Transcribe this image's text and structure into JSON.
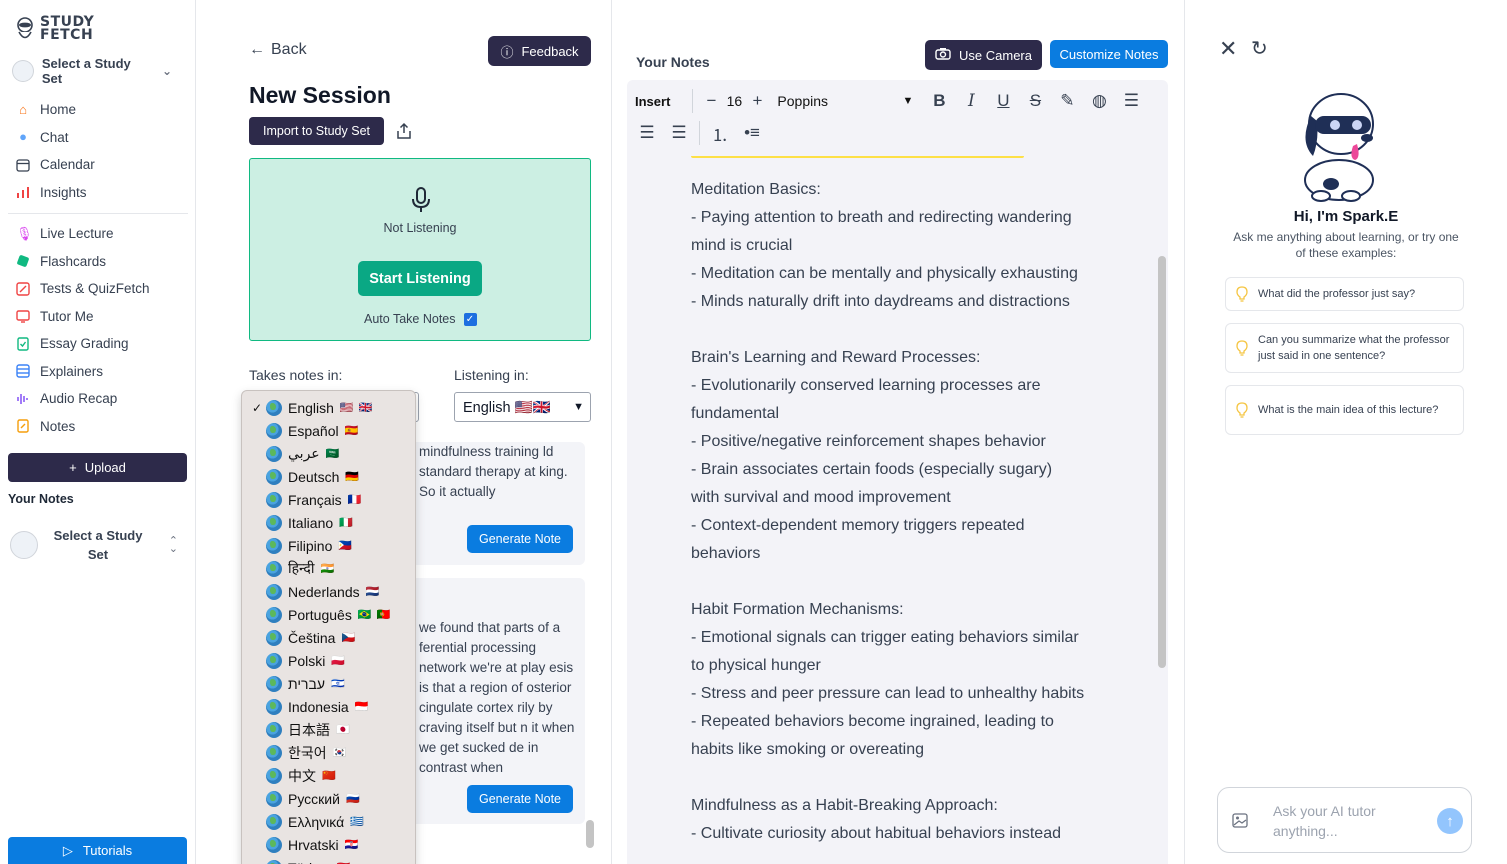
{
  "brand": {
    "name_line1": "STUDY",
    "name_line2": "FETCH"
  },
  "sidebar": {
    "study_set_select": "Select a Study Set",
    "nav_primary": [
      {
        "label": "Home",
        "icon": "home-icon",
        "color": "#f97316"
      },
      {
        "label": "Chat",
        "icon": "chat-icon",
        "color": "#60a5fa"
      },
      {
        "label": "Calendar",
        "icon": "calendar-icon",
        "color": "#374151"
      },
      {
        "label": "Insights",
        "icon": "insights-icon",
        "color": "#ef4444"
      }
    ],
    "nav_tools": [
      {
        "label": "Live Lecture",
        "icon": "mic-icon",
        "color": "#d946ef"
      },
      {
        "label": "Flashcards",
        "icon": "flashcards-icon",
        "color": "#10b981"
      },
      {
        "label": "Tests & QuizFetch",
        "icon": "test-icon",
        "color": "#ef4444"
      },
      {
        "label": "Tutor Me",
        "icon": "tutor-icon",
        "color": "#ef4444"
      },
      {
        "label": "Essay Grading",
        "icon": "essay-icon",
        "color": "#10b981"
      },
      {
        "label": "Explainers",
        "icon": "explainers-icon",
        "color": "#3b82f6"
      },
      {
        "label": "Audio Recap",
        "icon": "audio-icon",
        "color": "#8b5cf6"
      },
      {
        "label": "Notes",
        "icon": "notes-icon",
        "color": "#f59e0b"
      }
    ],
    "upload_label": "Upload",
    "your_notes_label": "Your Notes",
    "study_card_title": "Select a Study Set",
    "tutorials_label": "Tutorials"
  },
  "session": {
    "back_label": "Back",
    "feedback_label": "Feedback",
    "title": "New Session",
    "import_label": "Import to Study Set",
    "status": "Not Listening",
    "start_label": "Start Listening",
    "auto_notes_label": "Auto Take Notes",
    "auto_notes_checked": true,
    "takes_notes_label": "Takes notes in:",
    "listening_label": "Listening in:",
    "listening_value": "English 🇺🇸🇬🇧",
    "transcript_1": "mindfulness training ld standard therapy at king. So it actually",
    "transcript_2": "we found that parts of a ferential processing network we're at play esis is that a region of osterior cingulate cortex rily by craving itself but n it when we get sucked de in contrast when",
    "generate_label": "Generate Note"
  },
  "language_dropdown": {
    "selected": "English",
    "options": [
      {
        "name": "English",
        "flag": "🇺🇸 🇬🇧",
        "checked": true
      },
      {
        "name": "Español",
        "flag": "🇪🇸"
      },
      {
        "name": "عربي",
        "flag": "🇸🇦"
      },
      {
        "name": "Deutsch",
        "flag": "🇩🇪"
      },
      {
        "name": "Français",
        "flag": "🇫🇷"
      },
      {
        "name": "Italiano",
        "flag": "🇮🇹"
      },
      {
        "name": "Filipino",
        "flag": "🇵🇭"
      },
      {
        "name": "हिन्दी",
        "flag": "🇮🇳"
      },
      {
        "name": "Nederlands",
        "flag": "🇳🇱"
      },
      {
        "name": "Português",
        "flag": "🇧🇷 🇵🇹"
      },
      {
        "name": "Čeština",
        "flag": "🇨🇿"
      },
      {
        "name": "Polski",
        "flag": "🇵🇱"
      },
      {
        "name": "עברית",
        "flag": "🇮🇱"
      },
      {
        "name": "Indonesia",
        "flag": "🇮🇩"
      },
      {
        "name": "日本語",
        "flag": "🇯🇵"
      },
      {
        "name": "한국어",
        "flag": "🇰🇷"
      },
      {
        "name": "中文",
        "flag": "🇨🇳"
      },
      {
        "name": "Русский",
        "flag": "🇷🇺"
      },
      {
        "name": "Ελληνικά",
        "flag": "🇬🇷"
      },
      {
        "name": "Hrvatski",
        "flag": "🇭🇷"
      },
      {
        "name": "Türkçe",
        "flag": "🇹🇷"
      }
    ]
  },
  "notes": {
    "heading": "Your Notes",
    "camera_label": "Use Camera",
    "customize_label": "Customize Notes",
    "toolbar": {
      "insert_label": "Insert",
      "font_size": "16",
      "font_family": "Poppins"
    },
    "content": [
      "Meditation Basics:",
      "- Paying attention to breath and redirecting wandering",
      "mind is crucial",
      "- Meditation can be mentally and physically exhausting",
      "- Minds naturally drift into daydreams and distractions",
      "",
      "Brain's Learning and Reward Processes:",
      "- Evolutionarily conserved learning processes are",
      "fundamental",
      "- Positive/negative reinforcement shapes behavior",
      "- Brain associates certain foods (especially sugary)",
      "with survival and mood improvement",
      "- Context-dependent memory triggers repeated",
      "behaviors",
      "",
      "Habit Formation Mechanisms:",
      "- Emotional signals can trigger eating behaviors similar",
      "to physical hunger",
      "- Stress and peer pressure can lead to unhealthy habits",
      "- Repeated behaviors become ingrained, leading to",
      "habits like smoking or overeating",
      "",
      "Mindfulness as a Habit-Breaking Approach:",
      "- Cultivate curiosity about habitual behaviors instead"
    ]
  },
  "assistant": {
    "title": "Hi, I'm Spark.E",
    "subtitle": "Ask me anything about learning, or try one of these examples:",
    "suggestions": [
      "What did the professor just say?",
      "Can you summarize what the professor just said in one sentence?",
      "What is the main idea of this lecture?"
    ],
    "input_placeholder": "Ask your AI tutor anything..."
  },
  "colors": {
    "dark_button": "#2d2a4a",
    "primary_blue": "#0a7ce0",
    "listen_green": "#0aa884",
    "listen_bg": "#ccefe3"
  }
}
